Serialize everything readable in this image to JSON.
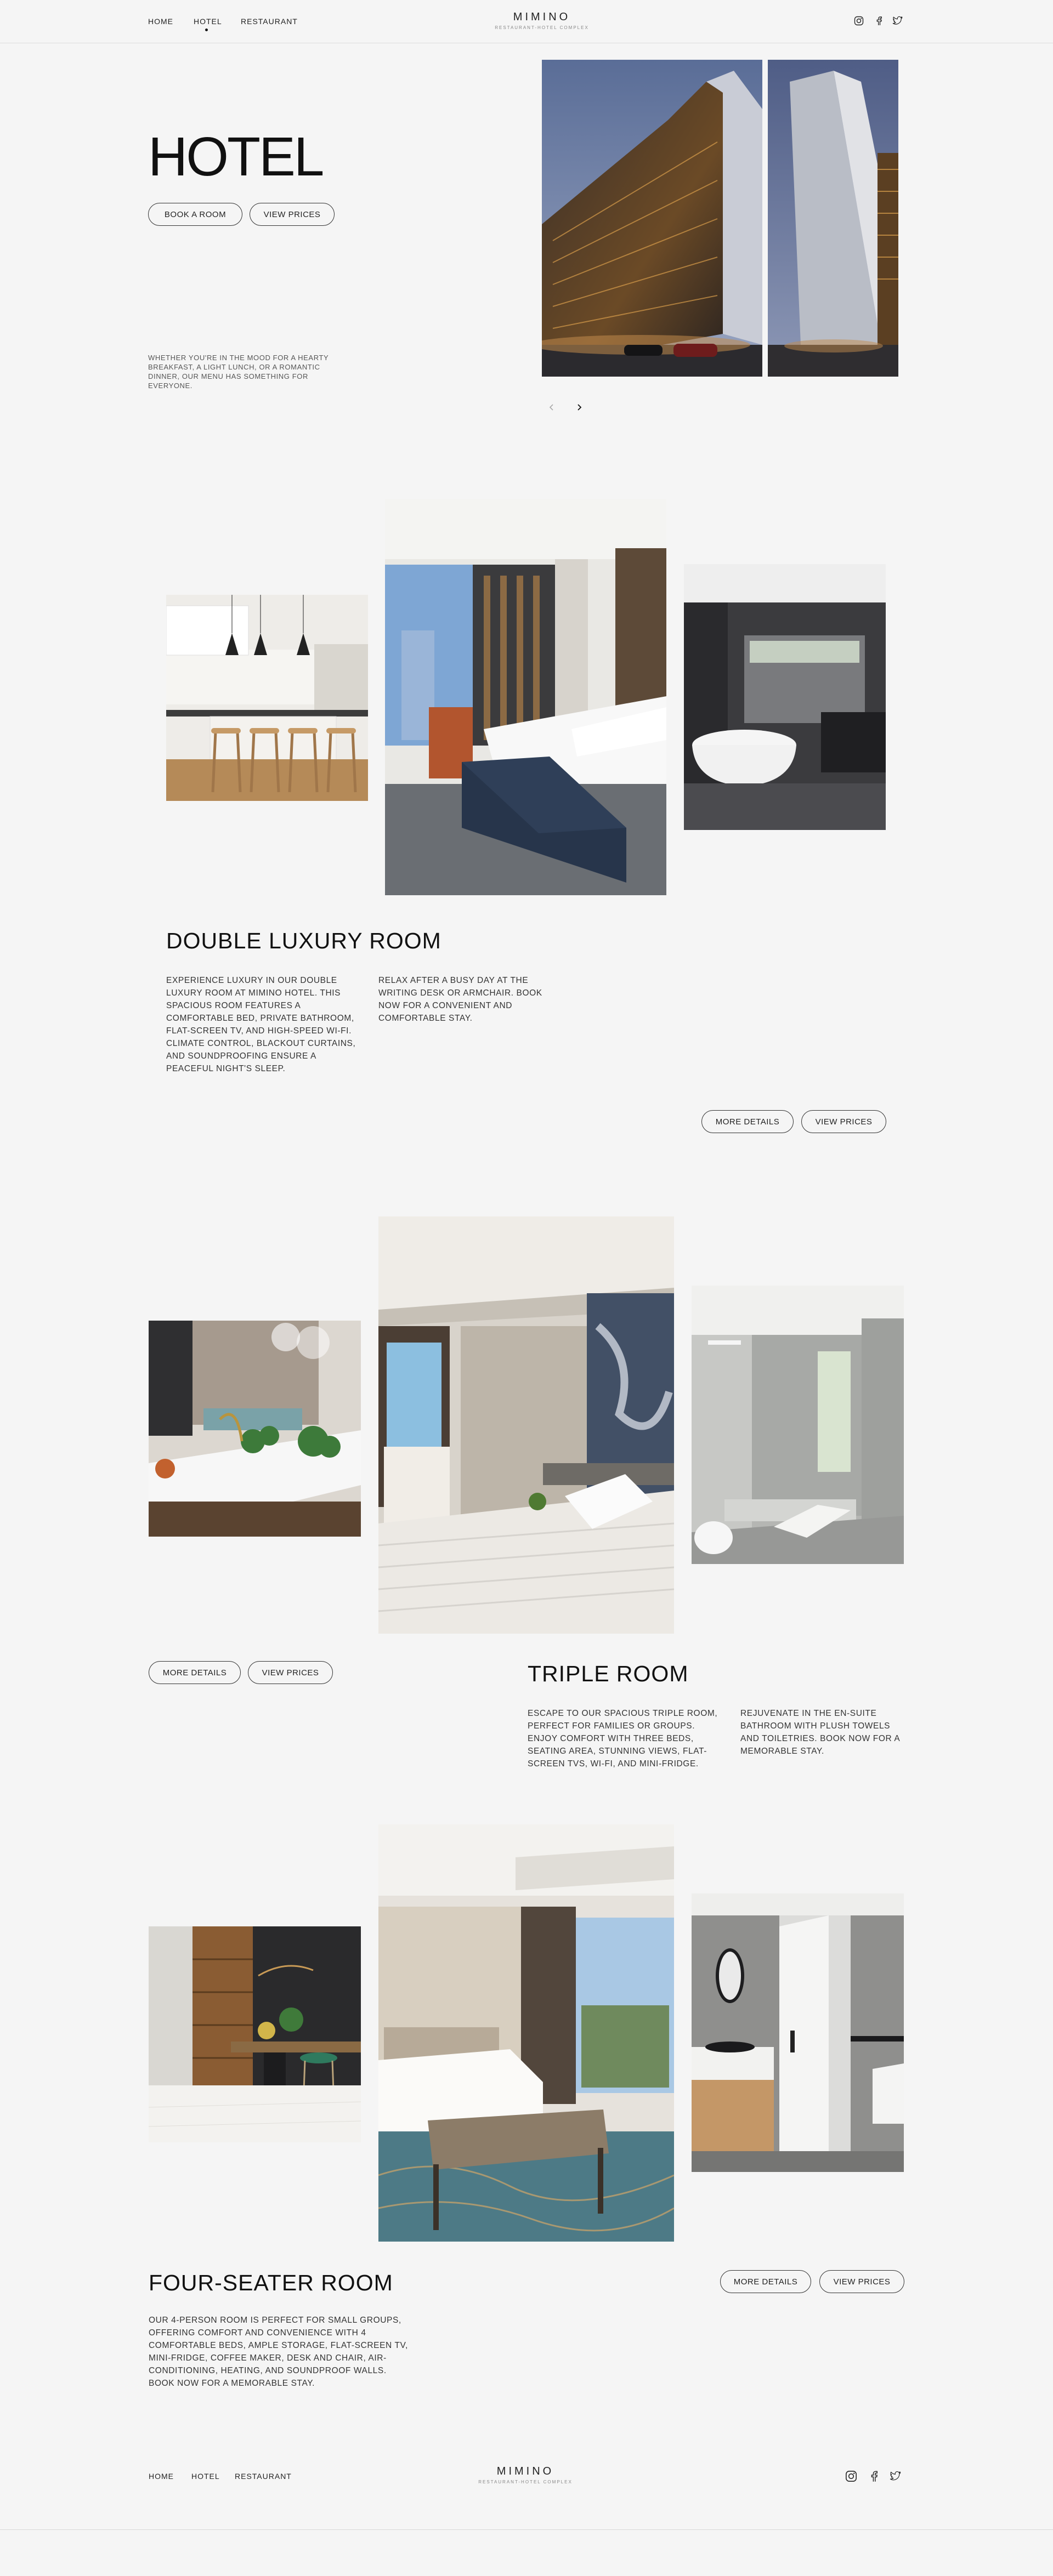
{
  "brand": {
    "name": "MIMINO",
    "tagline": "RESTAURANT-HOTEL COMPLEX"
  },
  "nav": {
    "items": [
      "HOME",
      "HOTEL",
      "RESTAURANT"
    ],
    "active": "HOTEL"
  },
  "social": [
    "instagram-icon",
    "facebook-icon",
    "twitter-icon"
  ],
  "hero": {
    "title": "HOTEL",
    "book_label": "BOOK A ROOM",
    "prices_label": "VIEW PRICES",
    "description": "WHETHER YOU'RE IN THE MOOD FOR A HEARTY BREAKFAST, A LIGHT LUNCH, OR A ROMANTIC DINNER, OUR MENU HAS SOMETHING FOR EVERYONE."
  },
  "rooms": [
    {
      "title": "DOUBLE LUXURY ROOM",
      "text1": "EXPERIENCE LUXURY IN OUR DOUBLE LUXURY ROOM AT MIMINO HOTEL. THIS SPACIOUS ROOM FEATURES A COMFORTABLE BED, PRIVATE BATHROOM, FLAT-SCREEN TV, AND HIGH-SPEED WI-FI. CLIMATE CONTROL, BLACKOUT CURTAINS, AND SOUNDPROOFING ENSURE A PEACEFUL NIGHT'S SLEEP.",
      "text2": "RELAX AFTER A BUSY DAY AT THE WRITING DESK OR ARMCHAIR. BOOK NOW FOR A CONVENIENT AND COMFORTABLE STAY.",
      "details_label": "MORE DETAILS",
      "prices_label": "VIEW PRICES"
    },
    {
      "title": "TRIPLE ROOM",
      "text1": "ESCAPE TO OUR SPACIOUS TRIPLE ROOM, PERFECT FOR FAMILIES OR GROUPS. ENJOY COMFORT WITH THREE BEDS, SEATING AREA, STUNNING VIEWS, FLAT-SCREEN TVS, WI-FI, AND MINI-FRIDGE.",
      "text2": "REJUVENATE IN THE EN-SUITE BATHROOM WITH PLUSH TOWELS AND TOILETRIES. BOOK NOW FOR A MEMORABLE STAY.",
      "details_label": "MORE DETAILS",
      "prices_label": "VIEW PRICES"
    },
    {
      "title": "FOUR-SEATER ROOM",
      "text1": "OUR 4-PERSON ROOM IS PERFECT FOR SMALL GROUPS, OFFERING COMFORT AND CONVENIENCE WITH 4 COMFORTABLE BEDS, AMPLE STORAGE, FLAT-SCREEN TV, MINI-FRIDGE, COFFEE MAKER, DESK AND CHAIR, AIR-CONDITIONING, HEATING, AND SOUNDPROOF WALLS. BOOK NOW FOR A MEMORABLE STAY.",
      "details_label": "MORE DETAILS",
      "prices_label": "VIEW PRICES"
    }
  ],
  "footer": {
    "nav": [
      "HOME",
      "HOTEL",
      "RESTAURANT"
    ],
    "name": "MIMINO",
    "tagline": "RESTAURANT-HOTEL COMPLEX"
  }
}
